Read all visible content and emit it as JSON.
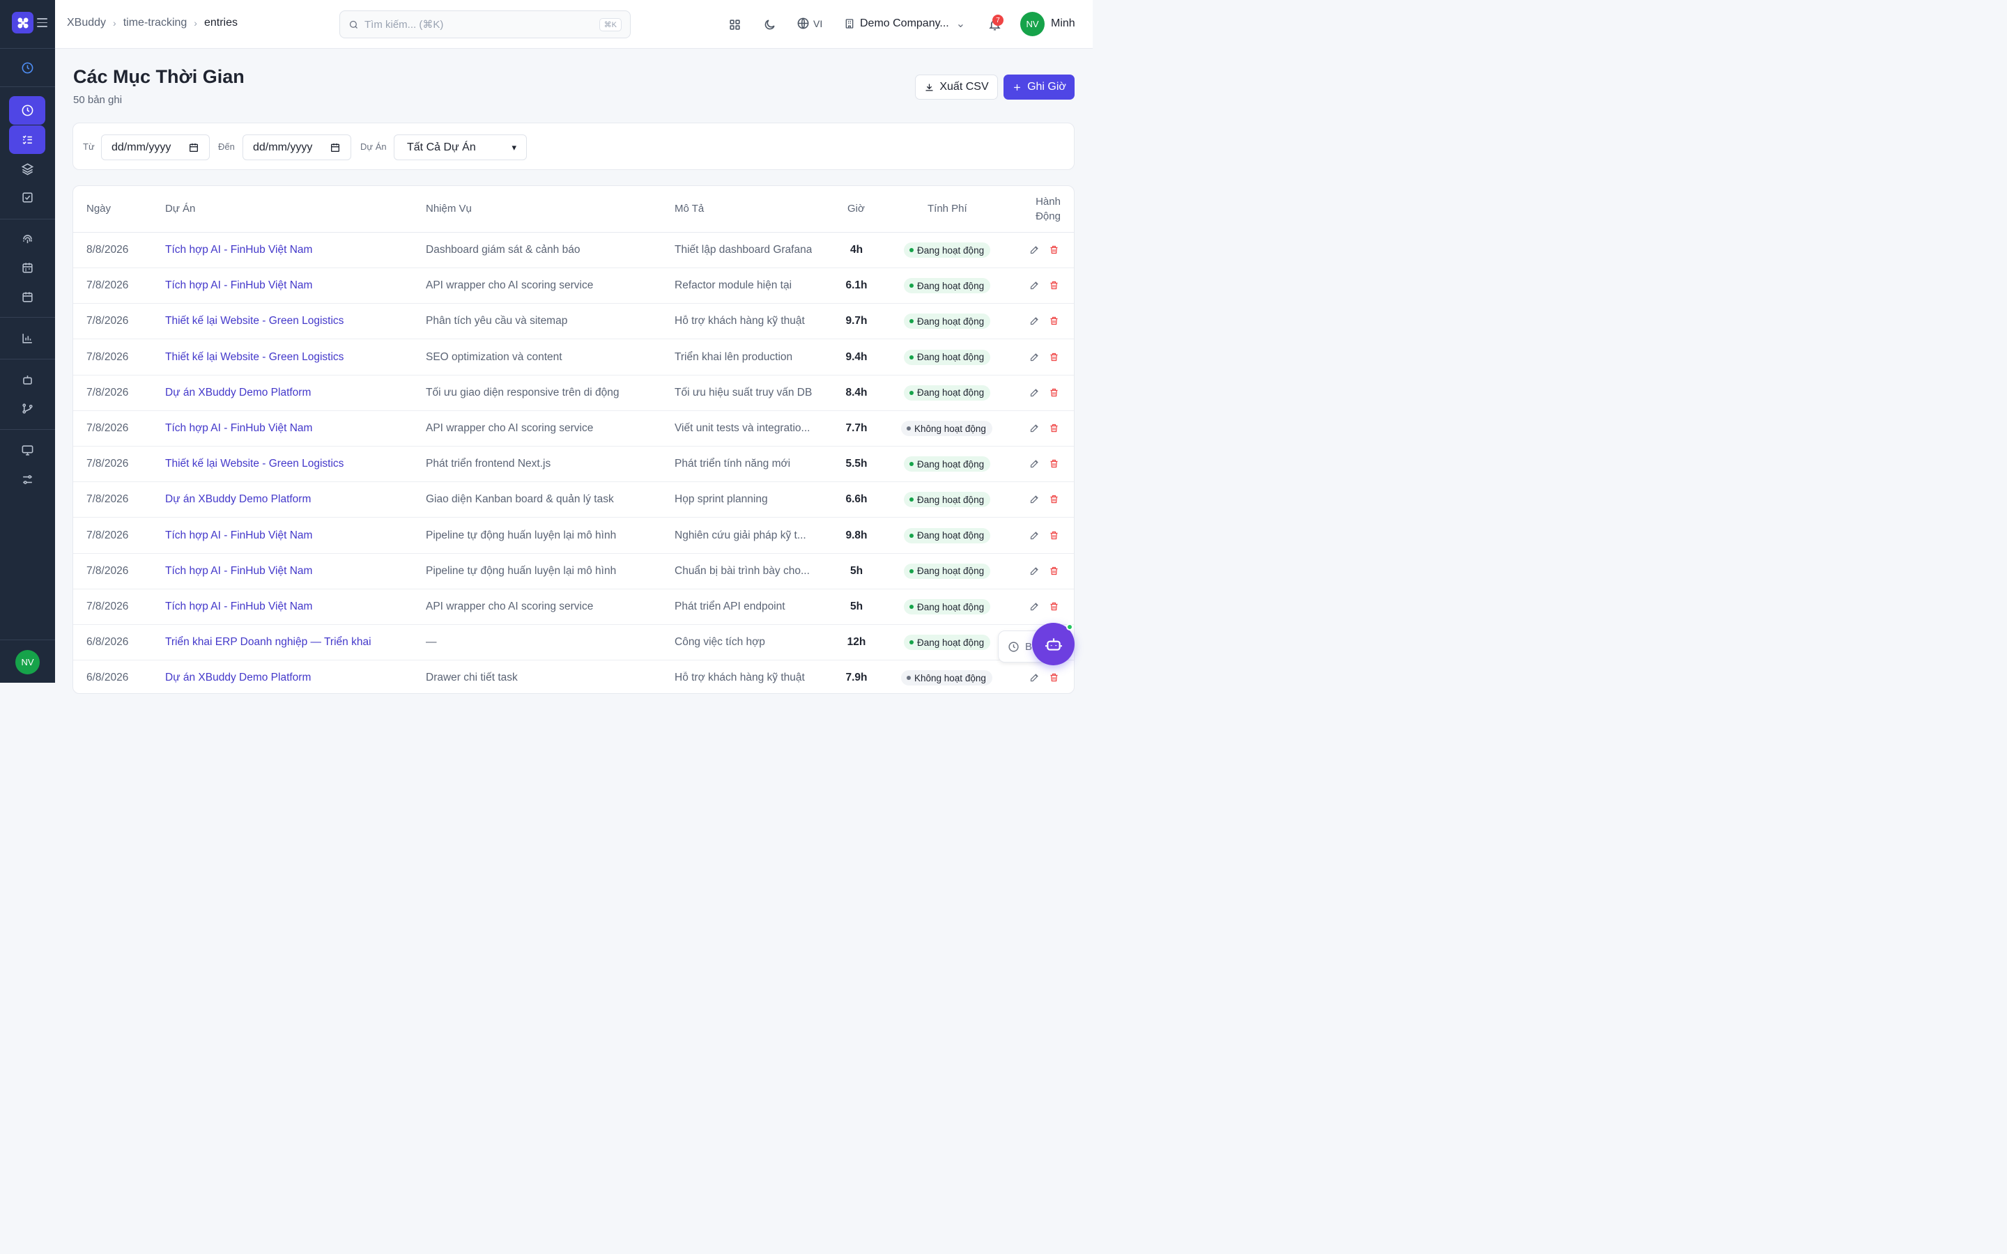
{
  "sidebar": {
    "logo_icon": "x-logo-icon",
    "menu_icon": "hamburger-icon",
    "avatar_initials": "NV"
  },
  "header": {
    "breadcrumb": [
      "XBuddy",
      "time-tracking",
      "entries"
    ],
    "search_placeholder": "Tìm kiếm... (⌘K)",
    "search_shortcut": "⌘K",
    "language": "VI",
    "company": "Demo Company...",
    "notification_count": "7",
    "user_initials": "NV",
    "user_name": "Minh"
  },
  "page": {
    "title": "Các Mục Thời Gian",
    "subtitle": "50 bản ghi",
    "export_label": "Xuất CSV",
    "add_label": "Ghi Giờ"
  },
  "filters": {
    "from_label": "Từ",
    "from_placeholder": "dd/mm/yyyy",
    "to_label": "Đến",
    "to_placeholder": "dd/mm/yyyy",
    "project_label": "Dự Án",
    "project_value": "Tất Cả Dự Án"
  },
  "table": {
    "columns": [
      "Ngày",
      "Dự Án",
      "Nhiệm Vụ",
      "Mô Tả",
      "Giờ",
      "Tính Phí",
      "Hành Động"
    ],
    "rows": [
      {
        "date": "8/8/2026",
        "project": "Tích hợp AI - FinHub Việt Nam",
        "task": "Dashboard giám sát & cảnh báo",
        "desc": "Thiết lập dashboard Grafana",
        "hours": "4h",
        "status": "Đang hoạt động",
        "active": true
      },
      {
        "date": "7/8/2026",
        "project": "Tích hợp AI - FinHub Việt Nam",
        "task": "API wrapper cho AI scoring service",
        "desc": "Refactor module hiện tại",
        "hours": "6.1h",
        "status": "Đang hoạt động",
        "active": true
      },
      {
        "date": "7/8/2026",
        "project": "Thiết kế lại Website - Green Logistics",
        "task": "Phân tích yêu cầu và sitemap",
        "desc": "Hỗ trợ khách hàng kỹ thuật",
        "hours": "9.7h",
        "status": "Đang hoạt động",
        "active": true
      },
      {
        "date": "7/8/2026",
        "project": "Thiết kế lại Website - Green Logistics",
        "task": "SEO optimization và content",
        "desc": "Triển khai lên production",
        "hours": "9.4h",
        "status": "Đang hoạt động",
        "active": true
      },
      {
        "date": "7/8/2026",
        "project": "Dự án XBuddy Demo Platform",
        "task": "Tối ưu giao diện responsive trên di động",
        "desc": "Tối ưu hiệu suất truy vấn DB",
        "hours": "8.4h",
        "status": "Đang hoạt động",
        "active": true
      },
      {
        "date": "7/8/2026",
        "project": "Tích hợp AI - FinHub Việt Nam",
        "task": "API wrapper cho AI scoring service",
        "desc": "Viết unit tests và integratio...",
        "hours": "7.7h",
        "status": "Không hoạt động",
        "active": false
      },
      {
        "date": "7/8/2026",
        "project": "Thiết kế lại Website - Green Logistics",
        "task": "Phát triển frontend Next.js",
        "desc": "Phát triển tính năng mới",
        "hours": "5.5h",
        "status": "Đang hoạt động",
        "active": true
      },
      {
        "date": "7/8/2026",
        "project": "Dự án XBuddy Demo Platform",
        "task": "Giao diện Kanban board & quản lý task",
        "desc": "Họp sprint planning",
        "hours": "6.6h",
        "status": "Đang hoạt động",
        "active": true
      },
      {
        "date": "7/8/2026",
        "project": "Tích hợp AI - FinHub Việt Nam",
        "task": "Pipeline tự động huấn luyện lại mô hình",
        "desc": "Nghiên cứu giải pháp kỹ t...",
        "hours": "9.8h",
        "status": "Đang hoạt động",
        "active": true
      },
      {
        "date": "7/8/2026",
        "project": "Tích hợp AI - FinHub Việt Nam",
        "task": "Pipeline tự động huấn luyện lại mô hình",
        "desc": "Chuẩn bị bài trình bày cho...",
        "hours": "5h",
        "status": "Đang hoạt động",
        "active": true
      },
      {
        "date": "7/8/2026",
        "project": "Tích hợp AI - FinHub Việt Nam",
        "task": "API wrapper cho AI scoring service",
        "desc": "Phát triển API endpoint",
        "hours": "5h",
        "status": "Đang hoạt động",
        "active": true
      },
      {
        "date": "6/8/2026",
        "project": "Triển khai ERP Doanh nghiệp — Triển khai",
        "task": "—",
        "desc": "Công việc tích hợp",
        "hours": "12h",
        "status": "Đang hoạt động",
        "active": true
      },
      {
        "date": "6/8/2026",
        "project": "Dự án XBuddy Demo Platform",
        "task": "Drawer chi tiết task",
        "desc": "Hỗ trợ khách hàng kỹ thuật",
        "hours": "7.9h",
        "status": "Không hoạt động",
        "active": false
      }
    ]
  },
  "floating": {
    "pill_text": "B",
    "assistant_icon": "robot-icon"
  },
  "colors": {
    "accent": "#4f46e5",
    "sidebar_bg": "#1f2a3b",
    "active_green": "#16a34a",
    "delete_red": "#ef4444"
  }
}
